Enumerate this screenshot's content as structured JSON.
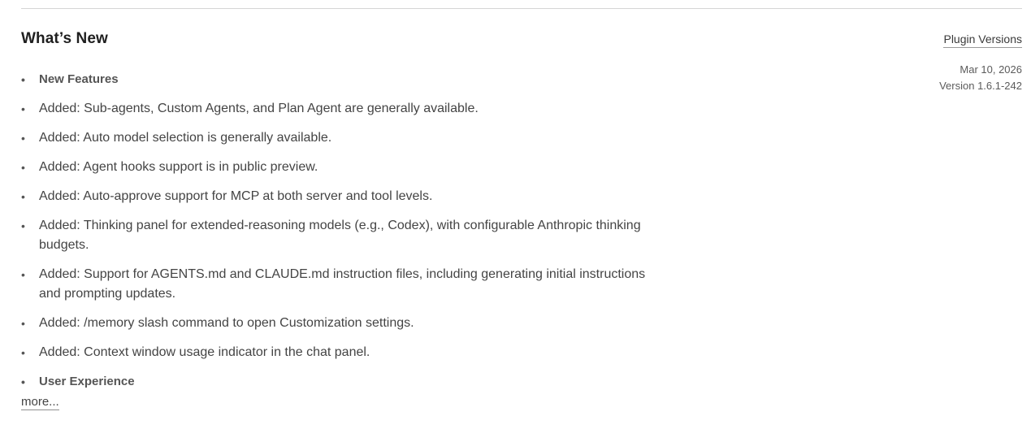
{
  "header": {
    "title": "What’s New",
    "plugin_versions_label": "Plugin Versions"
  },
  "meta": {
    "date": "Mar 10, 2026",
    "version": "Version 1.6.1-242"
  },
  "notes": [
    {
      "type": "heading",
      "text": "New Features"
    },
    {
      "type": "item",
      "text": "Added: Sub-agents, Custom Agents, and Plan Agent are generally available."
    },
    {
      "type": "item",
      "text": "Added: Auto model selection is generally available."
    },
    {
      "type": "item",
      "text": "Added: Agent hooks support is in public preview."
    },
    {
      "type": "item",
      "text": "Added: Auto-approve support for MCP at both server and tool levels."
    },
    {
      "type": "item",
      "text": "Added: Thinking panel for extended-reasoning models (e.g., Codex), with configurable Anthropic thinking budgets."
    },
    {
      "type": "item",
      "text": "Added: Support for AGENTS.md and CLAUDE.md instruction files, including generating initial instructions and prompting updates."
    },
    {
      "type": "item",
      "text": "Added: /memory slash command to open Customization settings."
    },
    {
      "type": "item",
      "text": "Added: Context window usage indicator in the chat panel."
    },
    {
      "type": "heading",
      "text": "User Experience"
    }
  ],
  "more_label": "more..."
}
